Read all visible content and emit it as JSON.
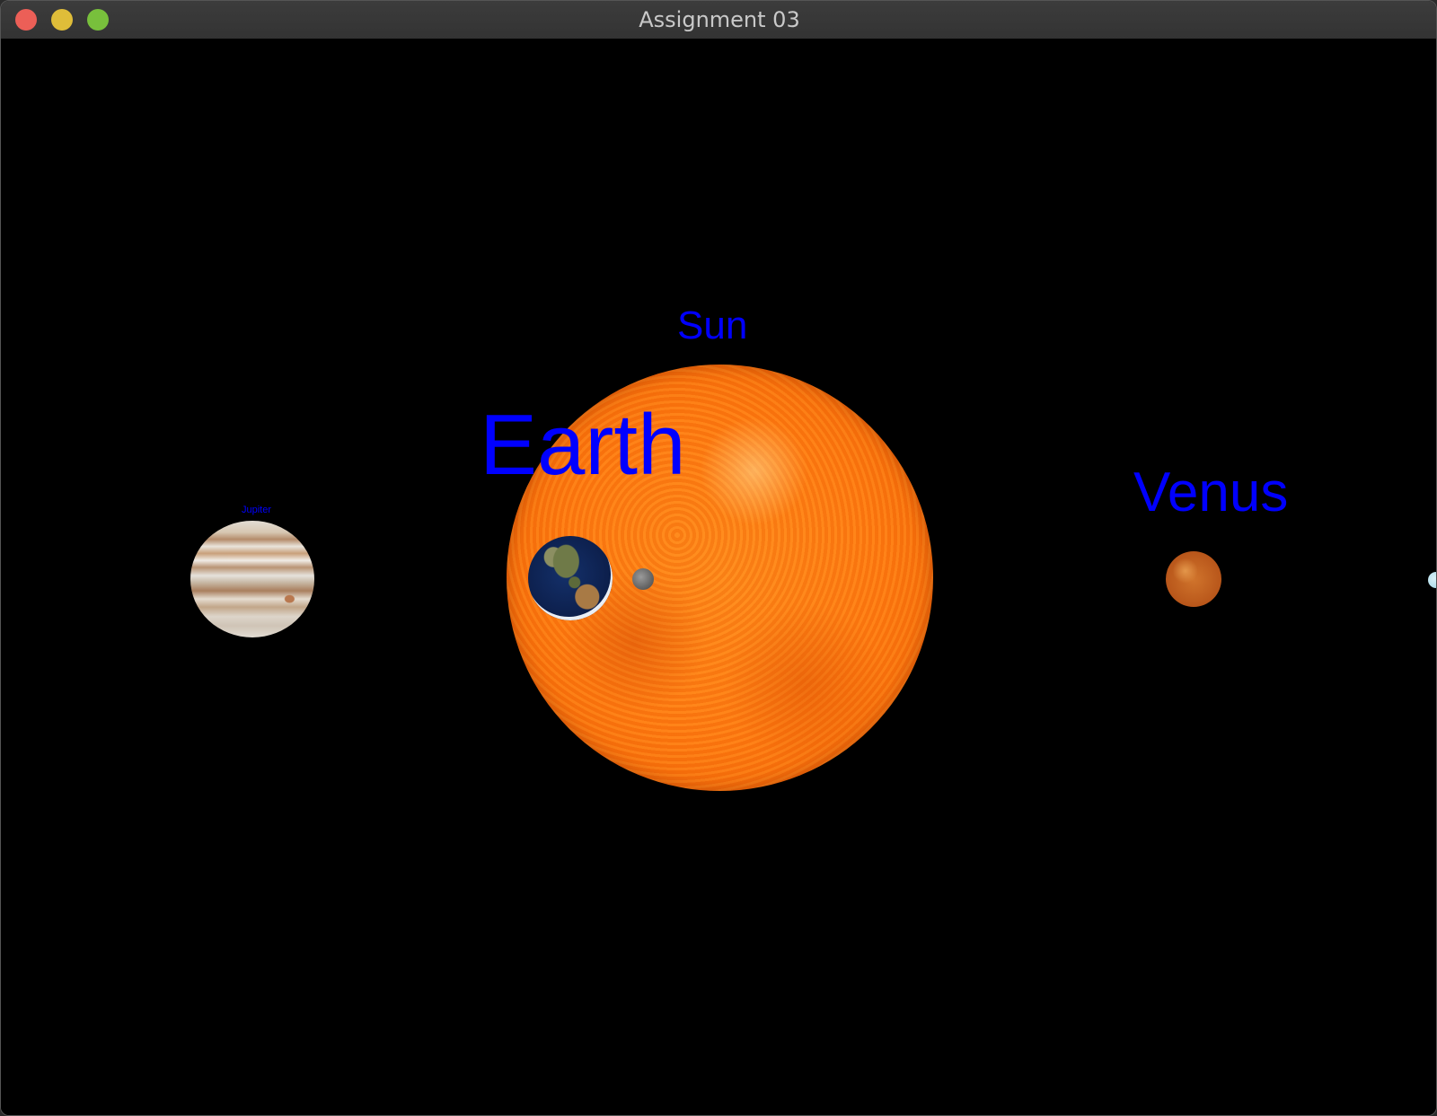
{
  "window": {
    "title": "Assignment 03"
  },
  "scene": {
    "labels": {
      "sun": "Sun",
      "earth": "Earth",
      "venus": "Venus",
      "jupiter": "Jupiter"
    },
    "label_color": "#0000ff",
    "background_color": "#000000"
  }
}
